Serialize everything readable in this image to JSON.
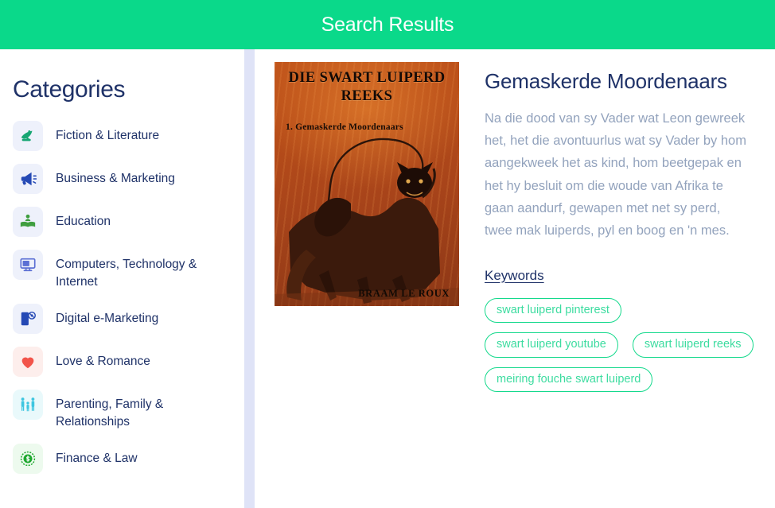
{
  "header": {
    "title": "Search Results",
    "background_color": "#0ad98a",
    "text_color": "#ffffff"
  },
  "sidebar": {
    "title": "Categories",
    "items": [
      {
        "label": "Fiction & Literature",
        "icon": "quill-hand-icon",
        "icon_color": "#17a673",
        "tile_color": "#eef1fb"
      },
      {
        "label": "Business & Marketing",
        "icon": "megaphone-icon",
        "icon_color": "#2549b5",
        "tile_color": "#eef1fb"
      },
      {
        "label": "Education",
        "icon": "reader-person-icon",
        "icon_color": "#3f9e3f",
        "tile_color": "#eef1fb"
      },
      {
        "label": "Computers, Technology & Internet",
        "icon": "monitor-icon",
        "icon_color": "#5b6fd4",
        "tile_color": "#eef1fb"
      },
      {
        "label": "Digital e-Marketing",
        "icon": "mobile-signal-icon",
        "icon_color": "#2549b5",
        "tile_color": "#eef1fb"
      },
      {
        "label": "Love & Romance",
        "icon": "heart-icon",
        "icon_color": "#f2544a",
        "tile_color": "#fdeeec"
      },
      {
        "label": "Parenting, Family & Relationships",
        "icon": "family-icon",
        "icon_color": "#3ec6e0",
        "tile_color": "#e9f9fb"
      },
      {
        "label": "Finance & Law",
        "icon": "dollar-coin-icon",
        "icon_color": "#1fa82f",
        "tile_color": "#edfaee"
      }
    ]
  },
  "scrollbar": {
    "track_color": "#dfe3f7",
    "thumb_color": "#14d98c"
  },
  "result": {
    "cover": {
      "title": "DIE SWART LUIPERD REEKS",
      "subtitle": "1. Gemaskerde Moordenaars",
      "author": "BRAAM LE ROUX",
      "background_color": "#b74c19"
    },
    "title": "Gemaskerde Moordenaars",
    "description": "Na die dood van sy Vader wat Leon gewreek het, het die avontuurlus wat sy Vader by hom aangekweek het as kind, hom beetgepak en het hy besluit om die woude van Afrika te gaan aandurf, gewapen met net sy perd, twee mak luiperds, pyl en boog en 'n mes.",
    "keywords_heading": "Keywords",
    "keywords": [
      "swart luiperd pinterest",
      "swart luiperd youtube",
      "swart luiperd reeks",
      "meiring fouche swart luiperd"
    ],
    "accent_color": "#14d98c",
    "title_color": "#1f3268",
    "description_color": "#93a3bd"
  }
}
